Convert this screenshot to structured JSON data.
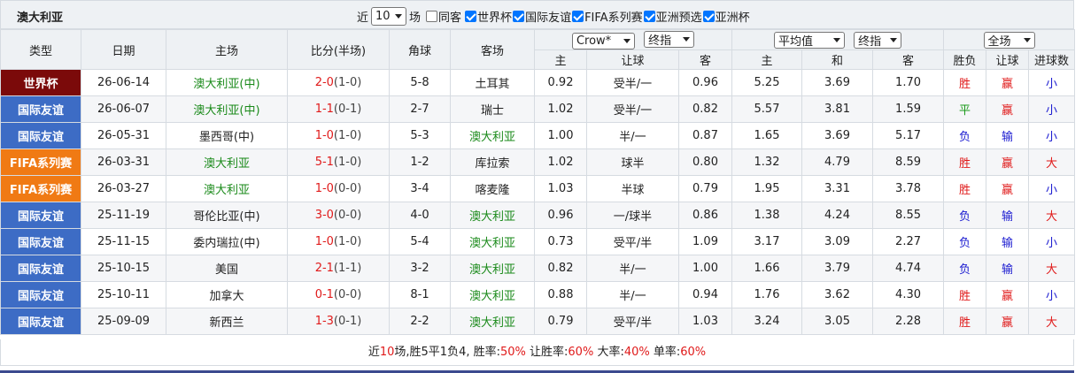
{
  "title": "澳大利亚",
  "filters": {
    "near_label": "近",
    "count_value": "10",
    "count_unit": "场",
    "same_label": "同客",
    "same_checked": false,
    "competitions": [
      {
        "label": "世界杯",
        "checked": true
      },
      {
        "label": "国际友谊",
        "checked": true
      },
      {
        "label": "FIFA系列赛",
        "checked": true
      },
      {
        "label": "亚洲预选",
        "checked": true
      },
      {
        "label": "亚洲杯",
        "checked": true
      }
    ]
  },
  "header": {
    "type": "类型",
    "date": "日期",
    "home": "主场",
    "score": "比分(半场)",
    "corner": "角球",
    "away": "客场",
    "company_select": "Crow*",
    "handicap_select": "终指",
    "odds_select": "平均值",
    "odds_final_select": "终指",
    "range_select": "全场",
    "sub": {
      "h_home": "主",
      "h_line": "让球",
      "h_away": "客",
      "o_home": "主",
      "o_draw": "和",
      "o_away": "客",
      "res": "胜负",
      "res_handicap": "让球",
      "goals": "进球数"
    }
  },
  "rows": [
    {
      "type": "世界杯",
      "type_color": "#7b0a0a",
      "date": "26-06-14",
      "home": "澳大利亚(中)",
      "score": "2-0",
      "half": "(1-0)",
      "corner": "5-8",
      "away": "土耳其",
      "h_home": "0.92",
      "h_line": "受半/一",
      "h_away": "0.96",
      "o_home": "5.25",
      "o_draw": "3.69",
      "o_away": "1.70",
      "res": "胜",
      "res_h": "赢",
      "goals": "小"
    },
    {
      "type": "国际友谊",
      "type_color": "#3d6cc5",
      "date": "26-06-07",
      "home": "澳大利亚(中)",
      "score": "1-1",
      "half": "(0-1)",
      "corner": "2-7",
      "away": "瑞士",
      "h_home": "1.02",
      "h_line": "受半/一",
      "h_away": "0.82",
      "o_home": "5.57",
      "o_draw": "3.81",
      "o_away": "1.59",
      "res": "平",
      "res_h": "赢",
      "goals": "小"
    },
    {
      "type": "国际友谊",
      "type_color": "#3d6cc5",
      "date": "26-05-31",
      "home": "墨西哥(中)",
      "score": "1-0",
      "half": "(1-0)",
      "corner": "5-3",
      "away": "澳大利亚",
      "h_home": "1.00",
      "h_line": "半/一",
      "h_away": "0.87",
      "o_home": "1.65",
      "o_draw": "3.69",
      "o_away": "5.17",
      "res": "负",
      "res_h": "输",
      "goals": "小"
    },
    {
      "type": "FIFA系列赛",
      "type_color": "#f07a14",
      "date": "26-03-31",
      "home": "澳大利亚",
      "score": "5-1",
      "half": "(1-0)",
      "corner": "1-2",
      "away": "库拉索",
      "h_home": "1.02",
      "h_line": "球半",
      "h_away": "0.80",
      "o_home": "1.32",
      "o_draw": "4.79",
      "o_away": "8.59",
      "res": "胜",
      "res_h": "赢",
      "goals": "大"
    },
    {
      "type": "FIFA系列赛",
      "type_color": "#f07a14",
      "date": "26-03-27",
      "home": "澳大利亚",
      "score": "1-0",
      "half": "(0-0)",
      "corner": "3-4",
      "away": "喀麦隆",
      "h_home": "1.03",
      "h_line": "半球",
      "h_away": "0.79",
      "o_home": "1.95",
      "o_draw": "3.31",
      "o_away": "3.78",
      "res": "胜",
      "res_h": "赢",
      "goals": "小"
    },
    {
      "type": "国际友谊",
      "type_color": "#3d6cc5",
      "date": "25-11-19",
      "home": "哥伦比亚(中)",
      "score": "3-0",
      "half": "(0-0)",
      "corner": "4-0",
      "away": "澳大利亚",
      "h_home": "0.96",
      "h_line": "一/球半",
      "h_away": "0.86",
      "o_home": "1.38",
      "o_draw": "4.24",
      "o_away": "8.55",
      "res": "负",
      "res_h": "输",
      "goals": "大"
    },
    {
      "type": "国际友谊",
      "type_color": "#3d6cc5",
      "date": "25-11-15",
      "home": "委内瑞拉(中)",
      "score": "1-0",
      "half": "(1-0)",
      "corner": "5-4",
      "away": "澳大利亚",
      "h_home": "0.73",
      "h_line": "受平/半",
      "h_away": "1.09",
      "o_home": "3.17",
      "o_draw": "3.09",
      "o_away": "2.27",
      "res": "负",
      "res_h": "输",
      "goals": "小"
    },
    {
      "type": "国际友谊",
      "type_color": "#3d6cc5",
      "date": "25-10-15",
      "home": "美国",
      "score": "2-1",
      "half": "(1-1)",
      "corner": "3-2",
      "away": "澳大利亚",
      "h_home": "0.82",
      "h_line": "半/一",
      "h_away": "1.00",
      "o_home": "1.66",
      "o_draw": "3.79",
      "o_away": "4.74",
      "res": "负",
      "res_h": "输",
      "goals": "大"
    },
    {
      "type": "国际友谊",
      "type_color": "#3d6cc5",
      "date": "25-10-11",
      "home": "加拿大",
      "score": "0-1",
      "half": "(0-0)",
      "corner": "8-1",
      "away": "澳大利亚",
      "h_home": "0.88",
      "h_line": "半/一",
      "h_away": "0.94",
      "o_home": "1.76",
      "o_draw": "3.62",
      "o_away": "4.30",
      "res": "胜",
      "res_h": "赢",
      "goals": "小"
    },
    {
      "type": "国际友谊",
      "type_color": "#3d6cc5",
      "date": "25-09-09",
      "home": "新西兰",
      "score": "1-3",
      "half": "(0-1)",
      "corner": "2-2",
      "away": "澳大利亚",
      "h_home": "0.79",
      "h_line": "受平/半",
      "h_away": "1.03",
      "o_home": "3.24",
      "o_draw": "3.05",
      "o_away": "2.28",
      "res": "胜",
      "res_h": "赢",
      "goals": "大"
    }
  ],
  "summary": {
    "prefix": "近",
    "count": "10",
    "text1": "场,胜5平1负4, 胜率:",
    "win_rate": "50%",
    "text2": " 让胜率:",
    "handicap_rate": "60%",
    "text3": " 大率:",
    "over_rate": "40%",
    "text4": " 单率:",
    "odd_rate": "60%"
  }
}
